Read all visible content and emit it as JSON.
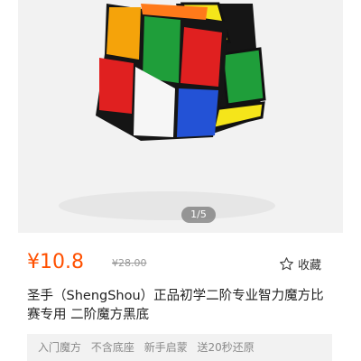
{
  "gallery": {
    "current": "1/5"
  },
  "product": {
    "price": "¥10.8",
    "original_price": "¥28.00",
    "favorite_label": "收藏",
    "title": "圣手（ShengShou）正品初学二阶专业智力魔方比赛专用 二阶魔方黑底",
    "tags": [
      "入门魔方",
      "不含底座",
      "新手启蒙",
      "送20秒还原"
    ]
  },
  "colors": {
    "price": "#ff5000",
    "cube_red": "#e02020",
    "cube_green": "#1f9e3a",
    "cube_orange": "#f5a30a",
    "cube_yellow": "#f5e51a",
    "cube_blue": "#2352d6",
    "cube_white": "#f6f6f6"
  },
  "icons": {
    "favorite": "star-outline-icon"
  }
}
